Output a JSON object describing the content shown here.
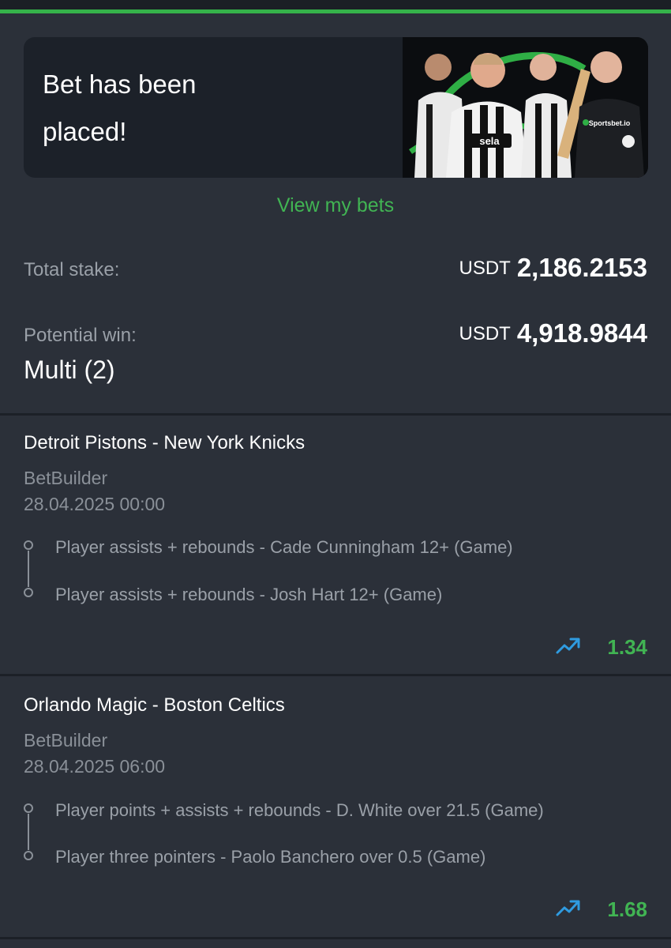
{
  "banner": {
    "message_line1": "Bet has been",
    "message_line2": "placed!",
    "brand": "Sportsbet.io",
    "shirt_sponsor": "sela"
  },
  "view_bets_label": "View my bets",
  "summary": {
    "total_stake_label": "Total stake:",
    "total_stake_currency": "USDT",
    "total_stake_amount": "2,186.2153",
    "potential_win_label": "Potential win:",
    "potential_win_currency": "USDT",
    "potential_win_amount": "4,918.9844",
    "bet_type": "Multi (2)"
  },
  "bets": [
    {
      "match": "Detroit Pistons - New York Knicks",
      "type": "BetBuilder",
      "datetime": "28.04.2025 00:00",
      "selections": [
        "Player assists + rebounds - Cade Cunningham 12+ (Game)",
        "Player assists + rebounds - Josh Hart 12+ (Game)"
      ],
      "odds": "1.34"
    },
    {
      "match": "Orlando Magic - Boston Celtics",
      "type": "BetBuilder",
      "datetime": "28.04.2025 06:00",
      "selections": [
        "Player points + assists + rebounds - D. White over 21.5 (Game)",
        "Player three pointers - Paolo Banchero over 0.5 (Game)"
      ],
      "odds": "1.68"
    }
  ],
  "icons": {
    "trend": "trending-up-icon",
    "selection_marker": "circle-icon"
  },
  "colors": {
    "accent_green": "#41b453",
    "top_bar_green": "#35b24a",
    "background": "#2b3039",
    "card_background": "#1c2129",
    "trend_icon_blue": "#2f9be0"
  }
}
